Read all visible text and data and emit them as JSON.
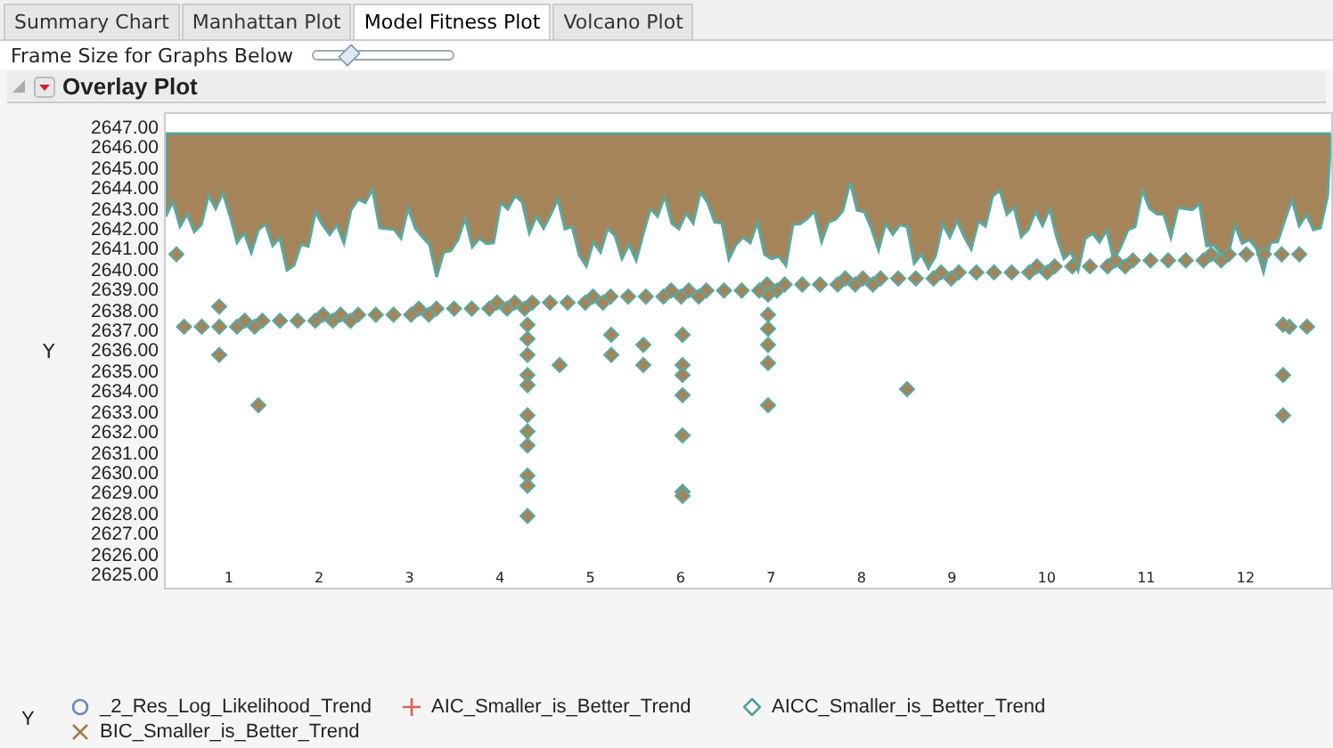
{
  "tabs": [
    {
      "label": "Summary Chart",
      "selected": false
    },
    {
      "label": "Manhattan Plot",
      "selected": false
    },
    {
      "label": "Model Fitness Plot",
      "selected": true
    },
    {
      "label": "Volcano Plot",
      "selected": false
    }
  ],
  "frame_size": {
    "label": "Frame Size for Graphs Below",
    "level": 0.25
  },
  "section": {
    "title": "Overlay Plot",
    "expanded": true
  },
  "plot": {
    "y_label": "Y",
    "y_ticks": [
      "2647.00",
      "2646.00",
      "2645.00",
      "2644.00",
      "2643.00",
      "2642.00",
      "2641.00",
      "2640.00",
      "2639.00",
      "2638.00",
      "2637.00",
      "2636.00",
      "2635.00",
      "2634.00",
      "2633.00",
      "2632.00",
      "2631.00",
      "2630.00",
      "2629.00",
      "2628.00",
      "2627.00",
      "2626.00",
      "2625.00"
    ],
    "x_labels": [
      "1",
      "2",
      "3",
      "4",
      "5",
      "6",
      "7",
      "8",
      "9",
      "10",
      "11",
      "12"
    ]
  },
  "legend": {
    "title": "Y",
    "items": [
      {
        "label": "_2_Res_Log_Likelihood_Trend",
        "kind": "circle",
        "color": "#6f86c4"
      },
      {
        "label": "AIC_Smaller_is_Better_Trend",
        "kind": "plus",
        "color": "#e0604f"
      },
      {
        "label": "AICC_Smaller_is_Better_Trend",
        "kind": "diamond",
        "color": "#4e9e98"
      },
      {
        "label": "BIC_Smaller_is_Better_Trend",
        "kind": "cross",
        "color": "#a57e52"
      }
    ]
  }
}
